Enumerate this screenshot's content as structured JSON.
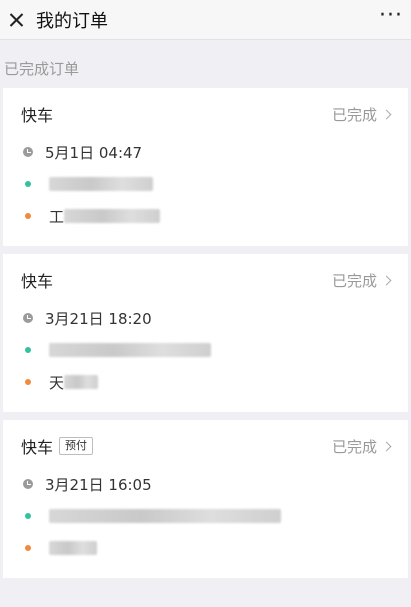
{
  "nav": {
    "title": "我的订单",
    "more": "···"
  },
  "section_title": "已完成订单",
  "orders": [
    {
      "type": "快车",
      "tag": "",
      "status": "已完成",
      "time": "5月1日 04:47",
      "start_first": "",
      "end_first": "工"
    },
    {
      "type": "快车",
      "tag": "",
      "status": "已完成",
      "time": "3月21日 18:20",
      "start_first": "",
      "end_first": "天"
    },
    {
      "type": "快车",
      "tag": "预付",
      "status": "已完成",
      "time": "3月21日 16:05",
      "start_first": "",
      "end_first": ""
    }
  ]
}
